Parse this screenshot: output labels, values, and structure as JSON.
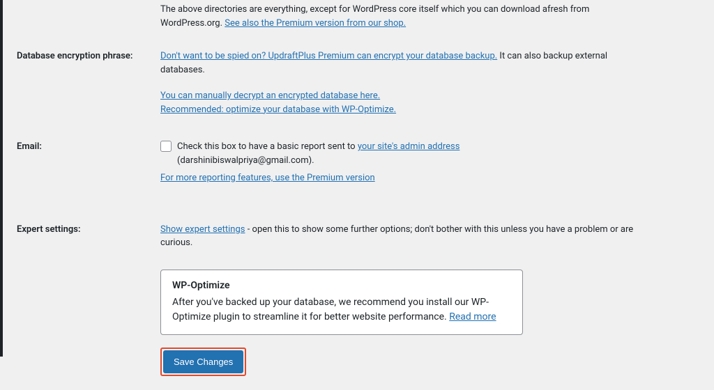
{
  "intro": {
    "text_before_link": "The above directories are everything, except for WordPress core itself which you can download afresh from WordPress.org. ",
    "premium_link": "See also the Premium version from our shop."
  },
  "db_encryption": {
    "label": "Database encryption phrase:",
    "spy_link": "Don't want to be spied on? UpdraftPlus Premium can encrypt your database backup.",
    "after_spy": " It can also backup external databases.",
    "decrypt_link": "You can manually decrypt an encrypted database here.",
    "optimize_link": "Recommended: optimize your database with WP-Optimize."
  },
  "email": {
    "label": "Email:",
    "checkbox_text": "Check this box to have a basic report sent to ",
    "admin_link": "your site's admin address",
    "address_paren": "(darshinibiswalpriya@gmail.com).",
    "premium_link": "For more reporting features, use the Premium version"
  },
  "expert": {
    "label": "Expert settings:",
    "show_link": "Show expert settings",
    "after_text": " - open this to show some further options; don't bother with this unless you have a problem or are curious."
  },
  "callout": {
    "title": "WP-Optimize",
    "body": "After you've backed up your database, we recommend you install our WP-Optimize plugin to streamline it for better website performance.  ",
    "read_more": "Read more"
  },
  "save_button": "Save Changes"
}
